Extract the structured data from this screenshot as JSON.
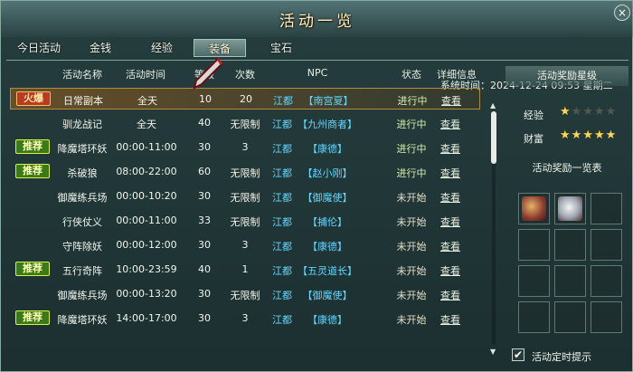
{
  "window": {
    "title": "活动一览",
    "close_label": "×"
  },
  "tabs": [
    {
      "label": "今日活动",
      "active": false
    },
    {
      "label": "金钱",
      "active": false
    },
    {
      "label": "经验",
      "active": false
    },
    {
      "label": "装备",
      "active": true
    },
    {
      "label": "宝石",
      "active": false
    }
  ],
  "system_time": "系统时间：2024-12-24  09:53  星期二",
  "table": {
    "headers": [
      "活动名称",
      "活动时间",
      "等级",
      "次数",
      "NPC",
      "状态",
      "详细信息"
    ],
    "rows": [
      {
        "badge": "火爆",
        "badge_type": "hot",
        "name": "日常副本",
        "time": "全天",
        "level": "10",
        "count": "20",
        "npc_place": "江都",
        "npc_name": "【南宫夏】",
        "status": "进行中",
        "detail": "查看",
        "highlight": true
      },
      {
        "badge": "",
        "badge_type": "",
        "name": "驯龙战记",
        "time": "全天",
        "level": "40",
        "count": "无限制",
        "npc_place": "江都",
        "npc_name": "【九州商者】",
        "status": "进行中",
        "detail": "查看",
        "highlight": false
      },
      {
        "badge": "推荐",
        "badge_type": "rec",
        "name": "降魔塔环妖",
        "time": "00:00-11:00",
        "level": "30",
        "count": "3",
        "npc_place": "江都",
        "npc_name": "【康德】",
        "status": "进行中",
        "detail": "查看",
        "highlight": false
      },
      {
        "badge": "推荐",
        "badge_type": "rec",
        "name": "杀破狼",
        "time": "08:00-22:00",
        "level": "60",
        "count": "无限制",
        "npc_place": "江都",
        "npc_name": "【赵小刚】",
        "status": "进行中",
        "detail": "查看",
        "highlight": false
      },
      {
        "badge": "",
        "badge_type": "",
        "name": "御魔练兵场",
        "time": "00:00-10:20",
        "level": "30",
        "count": "无限制",
        "npc_place": "江都",
        "npc_name": "【御魔使】",
        "status": "未开始",
        "detail": "查看",
        "highlight": false
      },
      {
        "badge": "",
        "badge_type": "",
        "name": "行侠仗义",
        "time": "00:00-11:00",
        "level": "33",
        "count": "无限制",
        "npc_place": "江都",
        "npc_name": "【捕伦】",
        "status": "未开始",
        "detail": "查看",
        "highlight": false
      },
      {
        "badge": "",
        "badge_type": "",
        "name": "守阵除妖",
        "time": "00:00-12:00",
        "level": "30",
        "count": "3",
        "npc_place": "江都",
        "npc_name": "【康德】",
        "status": "未开始",
        "detail": "查看",
        "highlight": false
      },
      {
        "badge": "推荐",
        "badge_type": "rec",
        "name": "五行奇阵",
        "time": "10:00-23:59",
        "level": "40",
        "count": "1",
        "npc_place": "江都",
        "npc_name": "【五灵道长】",
        "status": "未开始",
        "detail": "查看",
        "highlight": false
      },
      {
        "badge": "",
        "badge_type": "",
        "name": "御魔练兵场",
        "time": "00:00-13:20",
        "level": "30",
        "count": "无限制",
        "npc_place": "江都",
        "npc_name": "【御魔使】",
        "status": "未开始",
        "detail": "查看",
        "highlight": false
      },
      {
        "badge": "推荐",
        "badge_type": "rec",
        "name": "降魔塔环妖",
        "time": "14:00-17:00",
        "level": "30",
        "count": "3",
        "npc_place": "江都",
        "npc_name": "【康德】",
        "status": "未开始",
        "detail": "查看",
        "highlight": false
      }
    ]
  },
  "side": {
    "reward_level_title": "活动奖励星级",
    "exp_label": "经验",
    "exp_stars": 1,
    "wealth_label": "财富",
    "wealth_stars": 5,
    "max_stars": 5,
    "rewards_title": "活动奖励一览表",
    "reward_items": [
      "armor-item-icon",
      "gem-item-icon",
      "",
      "",
      "",
      "",
      "",
      "",
      "",
      "",
      "",
      ""
    ]
  },
  "notify": {
    "label": "活动定时提示",
    "checked": true,
    "check_glyph": "✔"
  },
  "colors": {
    "npc_link": "#5fd7ff",
    "hot_badge": "#b83a22",
    "rec_badge": "#3b7a16",
    "star": "#ffd84a"
  }
}
